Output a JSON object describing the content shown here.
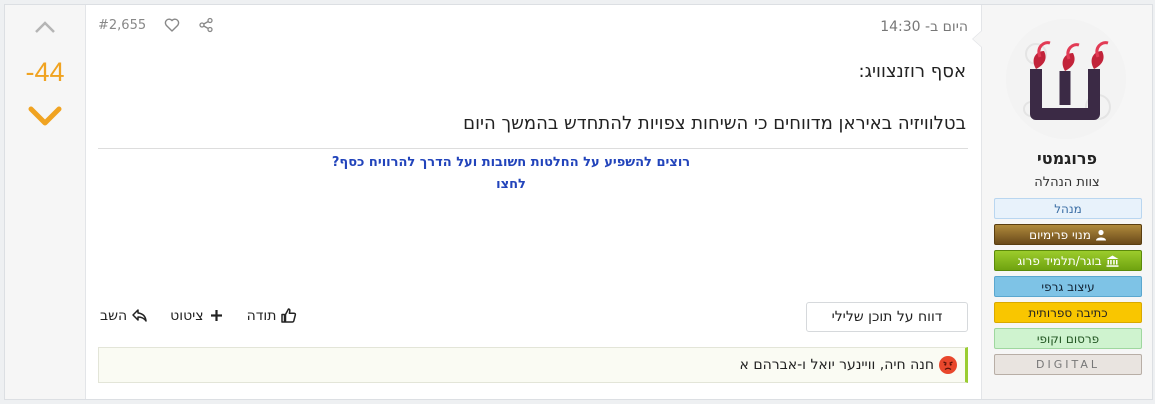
{
  "vote": {
    "score": "-44"
  },
  "meta": {
    "time": "היום ב- 14:30",
    "post_number": "#2,655"
  },
  "content": {
    "author_line": "אסף רוזנצוויג:",
    "text": "בטלוויזיה באיראן מדווחים כי השיחות צפויות להתחדש בהמשך היום"
  },
  "ad": {
    "line1": "רוצים להשפיע על החלטות חשובות ועל הדרך להרוויח כסף?",
    "line2": "לחצו"
  },
  "actions": {
    "report": "דווח על תוכן שלילי",
    "thanks": "תודה",
    "quote": "ציטוט",
    "reply": "השב"
  },
  "reactions": {
    "text": "חנה חיה, וויינער יואל ו-אברהם א"
  },
  "user": {
    "name": "פרוגמטי",
    "title": "צוות הנהלה",
    "badges": [
      "מנהל",
      "מנוי פרימיום",
      "בוגר/תלמיד פרוג",
      "עיצוב גרפי",
      "כתיבה ספרותית",
      "פרסום וקופי",
      "DIGITAL"
    ]
  },
  "colors": {
    "accent": "#f0a321",
    "link": "#2244bb",
    "reaction_border": "#9acd32"
  }
}
